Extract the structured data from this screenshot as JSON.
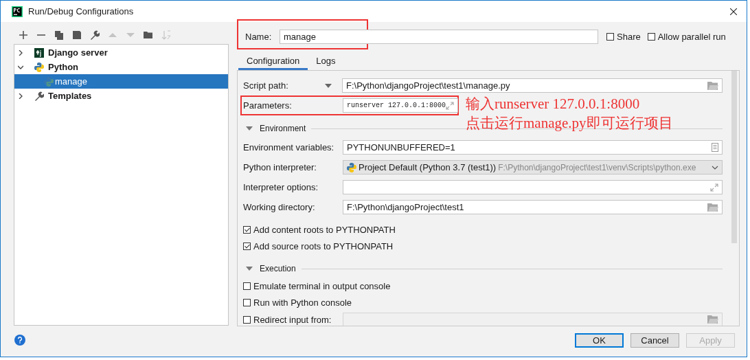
{
  "window": {
    "title": "Run/Debug Configurations"
  },
  "toolbar": [
    {
      "kind": "add",
      "disabled": false
    },
    {
      "kind": "remove",
      "disabled": false
    },
    {
      "kind": "copy",
      "disabled": false
    },
    {
      "kind": "save",
      "disabled": false
    },
    {
      "kind": "wrench",
      "disabled": false
    },
    {
      "kind": "up",
      "disabled": true
    },
    {
      "kind": "down",
      "disabled": true
    },
    {
      "kind": "folder",
      "disabled": false
    },
    {
      "kind": "sort",
      "disabled": true
    }
  ],
  "tree": [
    {
      "label": "Django server",
      "kind": "django",
      "expanded": false,
      "selected": false
    },
    {
      "label": "Python",
      "kind": "python",
      "expanded": true,
      "selected": false,
      "children": [
        {
          "label": "manage",
          "kind": "python-file",
          "selected": true
        }
      ]
    },
    {
      "label": "Templates",
      "kind": "wrench",
      "expanded": false,
      "selected": false
    }
  ],
  "name": {
    "label": "Name:",
    "value": "manage"
  },
  "options": [
    {
      "label": "Share",
      "checked": false
    },
    {
      "label": "Allow parallel run",
      "checked": false
    }
  ],
  "tabs": [
    {
      "label": "Configuration",
      "selected": true
    },
    {
      "label": "Logs",
      "selected": false
    }
  ],
  "rows": [
    {
      "kind": "path-field",
      "label": "Script path:",
      "value": "F:\\Python\\djangoProject\\test1\\manage.py",
      "dropdown": true
    },
    {
      "kind": "expand-field",
      "label": "Parameters:",
      "value": "runserver 127.0.0.1:8000",
      "mono": true,
      "highlighted": true
    },
    {
      "kind": "section",
      "label": "Environment",
      "expanded": true
    },
    {
      "kind": "list-field",
      "label": "Environment variables:",
      "value": "PYTHONUNBUFFERED=1"
    },
    {
      "kind": "combo",
      "label": "Python interpreter:",
      "value": "Project Default (Python 3.7 (test1))",
      "detail": "F:\\Python\\djangoProject\\test1\\venv\\Scripts\\python.exe"
    },
    {
      "kind": "expand-field",
      "label": "Interpreter options:"
    },
    {
      "kind": "path-field",
      "label": "Working directory:",
      "value": "F:\\Python\\djangoProject\\test1"
    },
    {
      "kind": "checkbox",
      "label": "Add content roots to PYTHONPATH",
      "checked": true
    },
    {
      "kind": "checkbox",
      "label": "Add source roots to PYTHONPATH",
      "checked": true
    },
    {
      "kind": "section",
      "label": "Execution",
      "expanded": true
    },
    {
      "kind": "checkbox",
      "label": "Emulate terminal in output console",
      "checked": false
    },
    {
      "kind": "checkbox",
      "label": "Run with Python console",
      "checked": false
    },
    {
      "kind": "checkbox-path-field",
      "label": "Redirect input from:",
      "checked": false,
      "disabled": true
    }
  ],
  "annotation": {
    "lines": [
      "输入runserver 127.0.0.1:8000",
      "点击运行manage.py即可运行项目"
    ]
  },
  "buttons": [
    {
      "label": "OK",
      "default": true,
      "disabled": false
    },
    {
      "label": "Cancel",
      "default": false,
      "disabled": false
    },
    {
      "label": "Apply",
      "default": false,
      "disabled": true
    }
  ]
}
